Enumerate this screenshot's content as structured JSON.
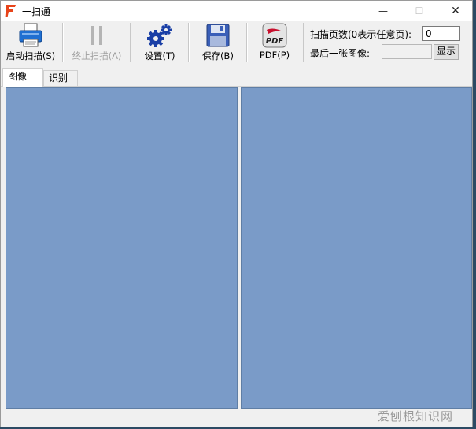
{
  "window": {
    "title": "一扫通",
    "minimize_glyph": "—",
    "maximize_glyph": "☐",
    "close_glyph": "✕",
    "logo_icon": "app-f-logo-icon",
    "accent": "#e8441a"
  },
  "toolbar": {
    "start_scan": "启动扫描(S)",
    "stop_scan": "终止扫描(A)",
    "settings": "设置(T)",
    "save": "保存(B)",
    "pdf": "PDF(P)",
    "pdf_icon_text": "PDF",
    "icons": [
      "scanner-icon",
      "pause-icon",
      "gears-icon",
      "floppy-disk-icon",
      "pdf-icon"
    ]
  },
  "options": {
    "pages_label": "扫描页数(0表示任意页):",
    "pages_value": "0",
    "last_image_label": "最后一张图像:",
    "last_image_value": "",
    "show_button": "显示"
  },
  "tabs": [
    {
      "label": "图像",
      "active": true
    },
    {
      "label": "识别",
      "active": false
    }
  ],
  "colors": {
    "panel": "#7a9bc8",
    "scanner": "#1f6fd1",
    "gears": "#1a3fa6",
    "save": "#3a5fb8"
  },
  "watermark": "爱刨根知识网"
}
